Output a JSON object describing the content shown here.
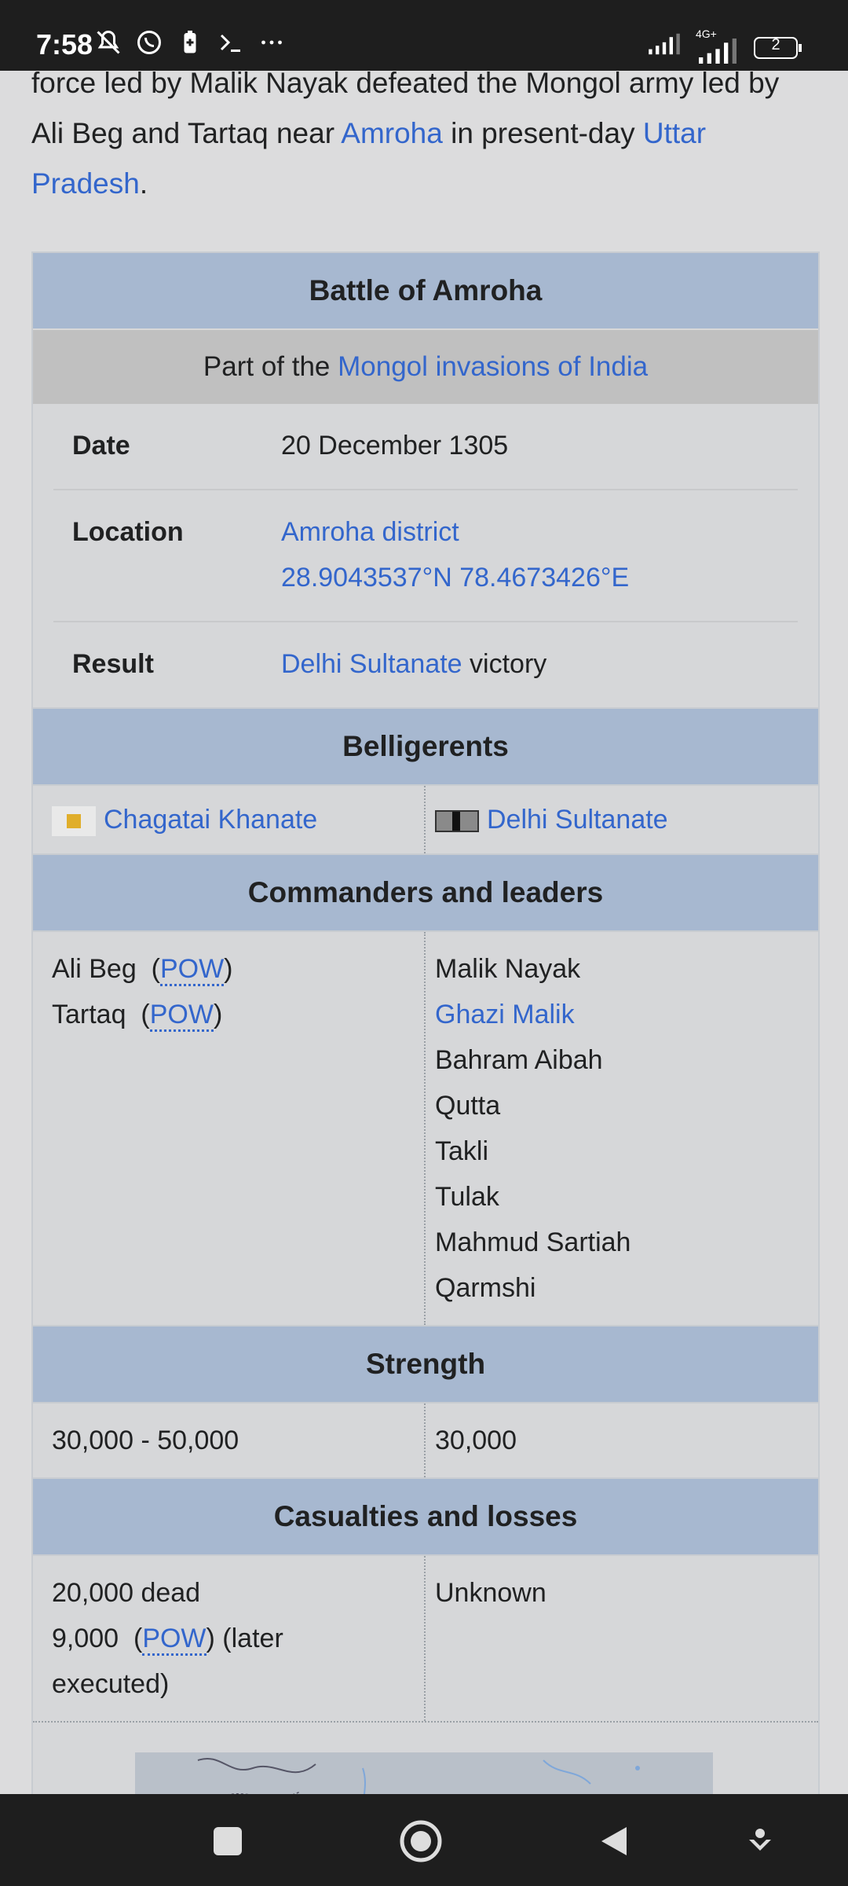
{
  "status": {
    "time": "7:58",
    "network": "4G+",
    "battery": "2"
  },
  "intro": {
    "part1": "force led by Malik Nayak defeated the Mongol army led by Ali Beg and Tartaq near ",
    "link1": "Amroha",
    "part2": " in present-day ",
    "link2": "Uttar Pradesh",
    "part3": "."
  },
  "infobox": {
    "title": "Battle of Amroha",
    "subtitle_prefix": "Part of the ",
    "subtitle_link": "Mongol invasions of India",
    "date_label": "Date",
    "date_value": "20 December 1305",
    "location_label": "Location",
    "location_link": "Amroha district",
    "location_coords": "28.9043537°N 78.4673426°E",
    "result_label": "Result",
    "result_link": "Delhi Sultanate",
    "result_text": " victory",
    "belligerents_header": "Belligerents",
    "belligerent_left": "Chagatai Khanate",
    "belligerent_right": "Delhi Sultanate",
    "commanders_header": "Commanders and leaders",
    "commanders_left": [
      {
        "name": "Ali Beg",
        "pow": "POW"
      },
      {
        "name": "Tartaq",
        "pow": "POW"
      }
    ],
    "commanders_right": [
      "Malik Nayak",
      "Ghazi Malik",
      "Bahram Aibah",
      "Qutta",
      "Takli",
      "Tulak",
      "Mahmud Sartiah",
      "Qarmshi"
    ],
    "strength_header": "Strength",
    "strength_left": "30,000 - 50,000",
    "strength_right": "30,000",
    "casualties_header": "Casualties and losses",
    "casualties_left_line1": "20,000 dead",
    "casualties_left_line2_prefix": "9,000",
    "casualties_left_pow": "POW",
    "casualties_left_line2_suffix": " (later executed)",
    "casualties_right": "Unknown"
  },
  "icons": {
    "status_left": [
      "notifications-off-icon",
      "whatsapp-icon",
      "battery-saver-icon",
      "terminal-icon",
      "more-icon"
    ],
    "status_right": [
      "signal-icon",
      "signal-4g-icon",
      "battery-icon"
    ],
    "nav": [
      "recents-icon",
      "home-icon",
      "back-icon",
      "assistant-icon"
    ]
  }
}
